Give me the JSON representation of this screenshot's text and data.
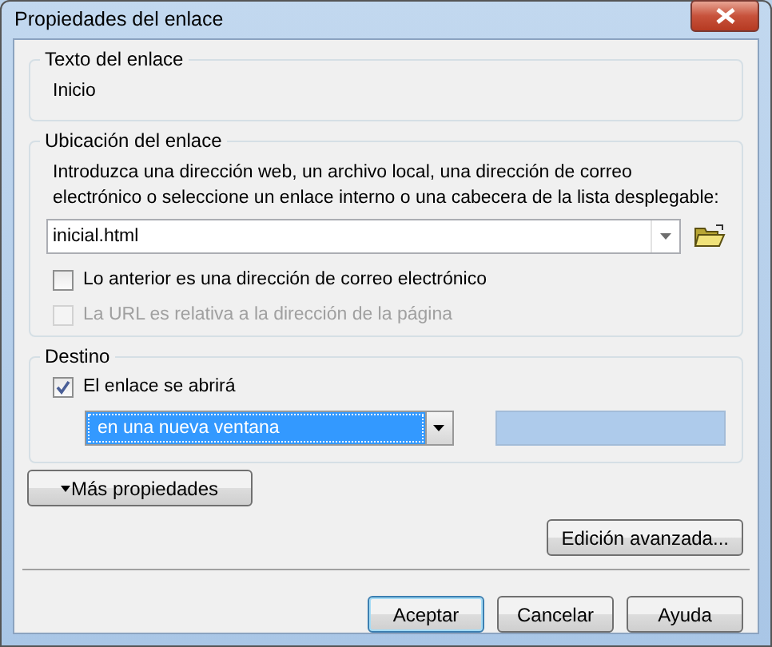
{
  "window": {
    "title": "Propiedades del enlace"
  },
  "link_text": {
    "label": "Texto del enlace",
    "value": "Inicio"
  },
  "link_location": {
    "label": "Ubicación del enlace",
    "instructions": "Introduzca una dirección web, un archivo local, una dirección de correo electrónico o seleccione un enlace interno o una cabecera de la lista desplegable:",
    "url_field": {
      "value": "inicial.html"
    },
    "options": [
      {
        "label": "Lo anterior es una dirección de correo electrónico",
        "checked": false,
        "disabled": false
      },
      {
        "label": "La URL es relativa a la dirección de la página",
        "checked": false,
        "disabled": true
      }
    ]
  },
  "target": {
    "label": "Destino",
    "option": {
      "label": "El enlace se abrirá",
      "checked": true,
      "disabled": false
    },
    "dropdown": {
      "value": "en una nueva ventana",
      "selected": true
    }
  },
  "more_button": {
    "label": "Más propiedades"
  },
  "advanced_button": {
    "label": "Edición avanzada..."
  },
  "buttons": [
    {
      "label": "Aceptar",
      "default": true
    },
    {
      "label": "Cancelar",
      "default": false
    },
    {
      "label": "Ayuda",
      "default": false
    }
  ]
}
